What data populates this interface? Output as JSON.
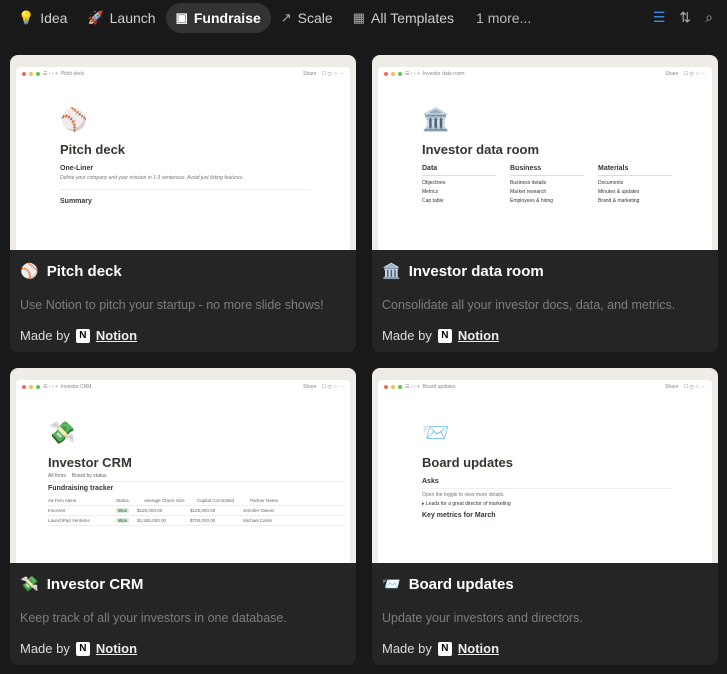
{
  "nav": {
    "tabs": [
      {
        "label": "Idea",
        "icon": "lightbulb-icon"
      },
      {
        "label": "Launch",
        "icon": "rocket-icon"
      },
      {
        "label": "Fundraise",
        "icon": "money-icon",
        "active": true
      },
      {
        "label": "Scale",
        "icon": "arrow-up-right-icon"
      },
      {
        "label": "All Templates",
        "icon": "grid-icon"
      }
    ],
    "more": "1 more..."
  },
  "common": {
    "made_by": "Made by",
    "author": "Notion",
    "share": "Share"
  },
  "cards": [
    {
      "title": "Pitch deck",
      "emoji": "⚾",
      "desc": "Use Notion to pitch your startup - no more slide shows!",
      "preview": {
        "crumb": "Pitch deck",
        "sub1": "One-Liner",
        "text1": "Define your company and your mission in 1-3 sentences. Avoid just listing features.",
        "sub2": "Summary"
      }
    },
    {
      "title": "Investor data room",
      "emoji": "🏛️",
      "desc": "Consolidate all your investor docs, data, and metrics.",
      "preview": {
        "crumb": "Investor data room",
        "cols": [
          {
            "h": "Data",
            "items": [
              "Objectives",
              "Metrics",
              "Cap table"
            ]
          },
          {
            "h": "Business",
            "items": [
              "Business details",
              "Market research",
              "Employees & hiring"
            ]
          },
          {
            "h": "Materials",
            "items": [
              "Documents",
              "Minutes & updates",
              "Brand & marketing"
            ]
          }
        ]
      }
    },
    {
      "title": "Investor CRM",
      "emoji": "💸",
      "desc": "Keep track of all your investors in one database.",
      "preview": {
        "crumb": "Investor CRM",
        "views": [
          "All firms",
          "Board by status"
        ],
        "db": "Fundraising tracker",
        "headers": [
          "Aa Firm name",
          "Status",
          "Average Check Size",
          "Capital Committed",
          "Partner Name"
        ],
        "rows": [
          [
            "InnoVest",
            "Won",
            "$125,000.00",
            "$125,000.00",
            "Jennifer Owens"
          ],
          [
            "LaunchPad Ventures",
            "Won",
            "$1,500,000.00",
            "$700,000.00",
            "Michael Carter"
          ]
        ]
      }
    },
    {
      "title": "Board updates",
      "emoji": "📨",
      "desc": "Update your investors and directors.",
      "preview": {
        "crumb": "Board updates",
        "sub1": "Asks",
        "text1": "Open the toggle to view more details.",
        "toggle": "Leads for a great director of marketing",
        "sub2": "Key metrics for March"
      }
    }
  ]
}
